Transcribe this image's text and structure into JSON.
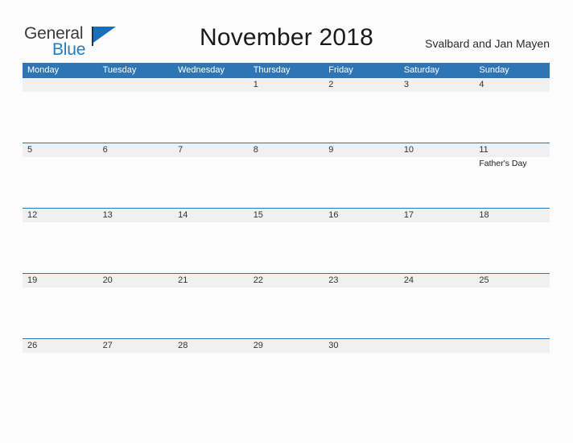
{
  "brand": {
    "name_part1": "General",
    "name_part2": "Blue",
    "flag_icon": "blue-triangle-flag-icon",
    "color_dark": "#3b3b3b",
    "color_blue": "#1d7fc3"
  },
  "header": {
    "title": "November 2018",
    "region": "Svalbard and Jan Mayen"
  },
  "calendar": {
    "accent_color": "#2e75b6",
    "band_color": "#f0f0f0",
    "weekdays": [
      "Monday",
      "Tuesday",
      "Wednesday",
      "Thursday",
      "Friday",
      "Saturday",
      "Sunday"
    ],
    "weeks": [
      {
        "days": [
          {
            "date": "",
            "event": ""
          },
          {
            "date": "",
            "event": ""
          },
          {
            "date": "",
            "event": ""
          },
          {
            "date": "1",
            "event": ""
          },
          {
            "date": "2",
            "event": ""
          },
          {
            "date": "3",
            "event": ""
          },
          {
            "date": "4",
            "event": ""
          }
        ]
      },
      {
        "days": [
          {
            "date": "5",
            "event": ""
          },
          {
            "date": "6",
            "event": ""
          },
          {
            "date": "7",
            "event": ""
          },
          {
            "date": "8",
            "event": ""
          },
          {
            "date": "9",
            "event": ""
          },
          {
            "date": "10",
            "event": ""
          },
          {
            "date": "11",
            "event": "Father's Day"
          }
        ]
      },
      {
        "days": [
          {
            "date": "12",
            "event": ""
          },
          {
            "date": "13",
            "event": ""
          },
          {
            "date": "14",
            "event": ""
          },
          {
            "date": "15",
            "event": ""
          },
          {
            "date": "16",
            "event": ""
          },
          {
            "date": "17",
            "event": ""
          },
          {
            "date": "18",
            "event": ""
          }
        ]
      },
      {
        "days": [
          {
            "date": "19",
            "event": ""
          },
          {
            "date": "20",
            "event": ""
          },
          {
            "date": "21",
            "event": ""
          },
          {
            "date": "22",
            "event": ""
          },
          {
            "date": "23",
            "event": ""
          },
          {
            "date": "24",
            "event": ""
          },
          {
            "date": "25",
            "event": ""
          }
        ]
      },
      {
        "days": [
          {
            "date": "26",
            "event": ""
          },
          {
            "date": "27",
            "event": ""
          },
          {
            "date": "28",
            "event": ""
          },
          {
            "date": "29",
            "event": ""
          },
          {
            "date": "30",
            "event": ""
          },
          {
            "date": "",
            "event": ""
          },
          {
            "date": "",
            "event": ""
          }
        ]
      }
    ]
  }
}
